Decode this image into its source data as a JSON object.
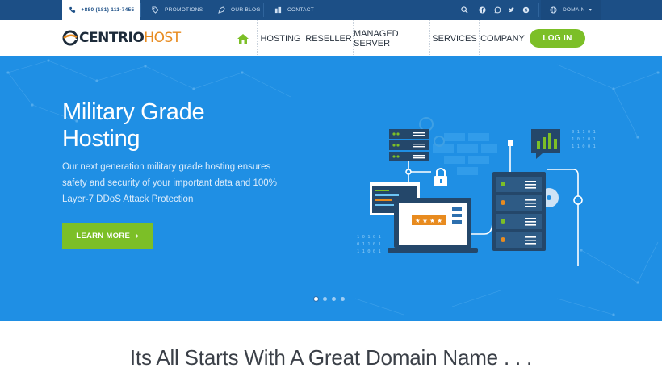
{
  "topbar": {
    "phone": "+880 (181) 111-7455",
    "promotions": "PROMOTIONS",
    "blog": "OUR BLOG",
    "contact": "CONTACT",
    "domain": "DOMAIN",
    "icons": [
      "phone-icon",
      "tag-icon",
      "blog-icon",
      "building-icon",
      "search-icon",
      "facebook-icon",
      "whatsapp-icon",
      "twitter-icon",
      "skype-icon",
      "globe-icon"
    ]
  },
  "logo": {
    "part1": "CENTRIO",
    "part2": "HOST"
  },
  "nav": {
    "hosting": "HOSTING",
    "reseller": "RESELLER",
    "managed": "MANAGED SERVER",
    "services": "SERVICES",
    "company": "COMPANY",
    "login": "LOG IN"
  },
  "hero": {
    "title_line1": "Military Grade",
    "title_line2": "Hosting",
    "description": "Our next generation military grade hosting ensures safety and security of your important data and 100% Layer-7 DDoS Attack Protection",
    "cta": "LEARN MORE",
    "binary_1": "0 1 1 0 1",
    "binary_2": "1 0 1 0 1",
    "binary_3": "1 1 0 0 1",
    "stars": "★ ★ ★ ★",
    "slide_count": 4,
    "active_slide": 1
  },
  "domain_section": {
    "heading": "Its All Starts With A Great Domain Name . . ."
  },
  "colors": {
    "topbar": "#1c4f86",
    "accent_green": "#7cbf27",
    "hero_blue": "#1f8fe4",
    "logo_orange": "#e88b1f"
  }
}
